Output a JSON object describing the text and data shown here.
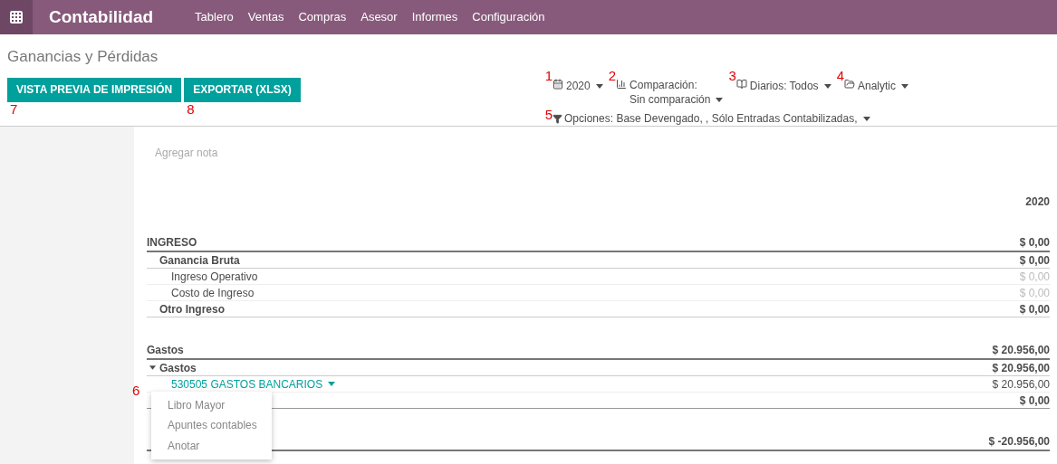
{
  "app_title": "Contabilidad",
  "menu": [
    "Tablero",
    "Ventas",
    "Compras",
    "Asesor",
    "Informes",
    "Configuración"
  ],
  "page_title": "Ganancias y Pérdidas",
  "buttons": [
    {
      "label": "VISTA PREVIA DE IMPRESIÓN",
      "marker": "7"
    },
    {
      "label": "EXPORTAR (XLSX)",
      "marker": "8"
    }
  ],
  "filters": [
    {
      "marker": "1",
      "kind": "calendar",
      "label": "2020"
    },
    {
      "marker": "2",
      "kind": "chart",
      "label": "Comparación:",
      "value": "Sin comparación"
    },
    {
      "marker": "3",
      "kind": "book",
      "label": "Diarios: Todos"
    },
    {
      "marker": "4",
      "kind": "folder",
      "label": "Analytic"
    }
  ],
  "options": {
    "marker": "5",
    "label": "Opciones: Base Devengado, , Sólo Entradas Contabilizadas,"
  },
  "note_placeholder": "Agregar nota",
  "column_header": "2020",
  "sections": [
    {
      "label": "INGRESO",
      "value": "$ 0,00",
      "groups": [
        {
          "label": "Ganancia Bruta",
          "value": "$ 0,00",
          "expanded": false,
          "lines": [
            {
              "kind": "line",
              "label": "Ingreso Operativo",
              "value": "$ 0,00"
            },
            {
              "kind": "line",
              "label": "Costo de Ingreso",
              "value": "$ 0,00"
            }
          ]
        },
        {
          "label": "Otro Ingreso",
          "value": "$ 0,00",
          "expanded": false
        }
      ]
    },
    {
      "label": "Gastos",
      "value": "$ 20.956,00",
      "groups": [
        {
          "label": "Gastos",
          "value": "$ 20.956,00",
          "expanded": true,
          "lines": [
            {
              "kind": "account",
              "label": "530505 GASTOS BANCARIOS",
              "value": "$ 20.956,00"
            },
            {
              "kind": "total",
              "value": "$ 0,00"
            }
          ]
        }
      ]
    },
    {
      "value": "$ -20.956,00"
    }
  ],
  "context_menu": {
    "marker": "6",
    "items": [
      "Libro Mayor",
      "Apuntes contables",
      "Anotar"
    ]
  }
}
